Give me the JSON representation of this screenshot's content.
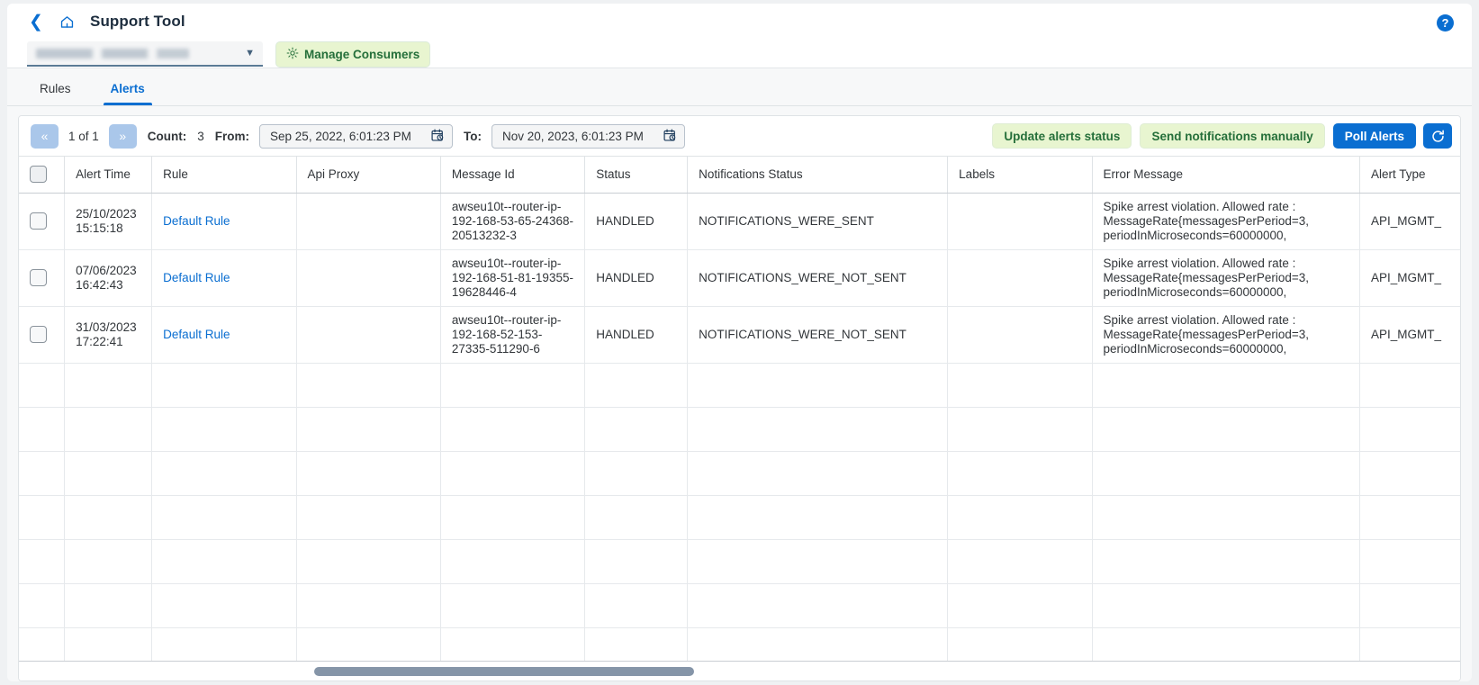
{
  "header": {
    "back_icon": "chevron-left-icon",
    "home_icon": "home-icon",
    "title": "Support Tool",
    "help_icon": "?",
    "consumer_select_value": "",
    "manage_consumers_label": "Manage Consumers",
    "gear_icon": "gear-icon"
  },
  "tabs": [
    {
      "label": "Rules",
      "active": false
    },
    {
      "label": "Alerts",
      "active": true
    }
  ],
  "toolbar": {
    "first_page_icon": "«",
    "next_page_icon": "»",
    "page_indicator": "1 of 1",
    "count_label": "Count:",
    "count_value": "3",
    "from_label": "From:",
    "from_value": "Sep 25, 2022, 6:01:23 PM",
    "to_label": "To:",
    "to_value": "Nov 20, 2023, 6:01:23 PM",
    "calendar_icon": "calendar-icon",
    "update_alerts_status_label": "Update alerts status",
    "send_notifications_label": "Send notifications manually",
    "poll_alerts_label": "Poll Alerts",
    "refresh_icon": "refresh-icon"
  },
  "table": {
    "columns": [
      "",
      "Alert Time",
      "Rule",
      "Api Proxy",
      "Message Id",
      "Status",
      "Notifications Status",
      "Labels",
      "Error Message",
      "Alert Type",
      ""
    ],
    "rows": [
      {
        "alert_time": "25/10/2023 15:15:18",
        "rule": "Default Rule",
        "api_proxy": "",
        "message_id": "awseu10t--router-ip-192-168-53-65-24368-20513232-3",
        "status": "HANDLED",
        "notifications_status": "NOTIFICATIONS_WERE_SENT",
        "labels": "",
        "error_message": "Spike arrest violation. Allowed rate : MessageRate{messagesPerPeriod=3, periodInMicroseconds=60000000,",
        "alert_type": "API_MGMT_",
        "chevron": "›"
      },
      {
        "alert_time": "07/06/2023 16:42:43",
        "rule": "Default Rule",
        "api_proxy": "",
        "message_id": "awseu10t--router-ip-192-168-51-81-19355-19628446-4",
        "status": "HANDLED",
        "notifications_status": "NOTIFICATIONS_WERE_NOT_SENT",
        "labels": "",
        "error_message": "Spike arrest violation. Allowed rate : MessageRate{messagesPerPeriod=3, periodInMicroseconds=60000000,",
        "alert_type": "API_MGMT_",
        "chevron": "›"
      },
      {
        "alert_time": "31/03/2023 17:22:41",
        "rule": "Default Rule",
        "api_proxy": "",
        "message_id": "awseu10t--router-ip-192-168-52-153-27335-511290-6",
        "status": "HANDLED",
        "notifications_status": "NOTIFICATIONS_WERE_NOT_SENT",
        "labels": "",
        "error_message": "Spike arrest violation. Allowed rate : MessageRate{messagesPerPeriod=3, periodInMicroseconds=60000000,",
        "alert_type": "API_MGMT_",
        "chevron": "›"
      }
    ],
    "empty_row_count": 7
  },
  "colors": {
    "accent": "#0a6ed1",
    "success_pill_bg": "#e8f5d0",
    "success_pill_text": "#256f3a",
    "text": "#32363a",
    "border": "#dfe3e6"
  }
}
